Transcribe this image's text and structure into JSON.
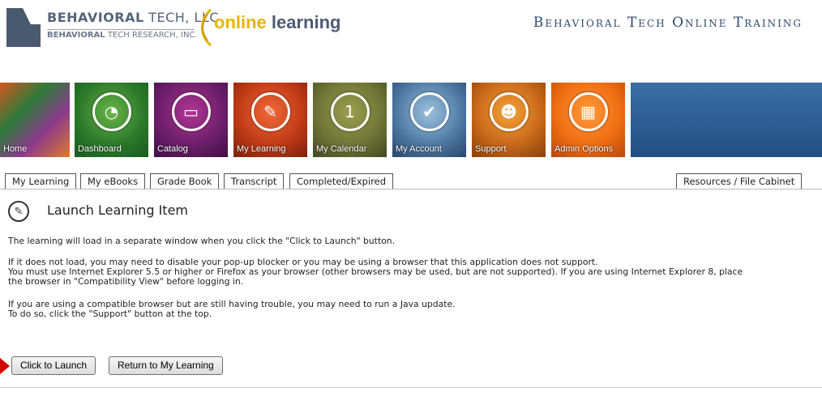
{
  "brand": {
    "company_line1_bold": "BEHAVIORAL",
    "company_line1_light": " TECH, LLC",
    "company_line2_bold": "BEHAVIORAL",
    "company_line2_light": " TECH RESEARCH, INC.",
    "online_learning_part1": "online",
    "online_learning_part2": " learning",
    "site_title": "Behavioral Tech Online Training"
  },
  "nav": {
    "items": [
      {
        "label": "Home",
        "icon": "home-icon"
      },
      {
        "label": "Dashboard",
        "icon": "gauge-icon",
        "glyph": "◔"
      },
      {
        "label": "Catalog",
        "icon": "folder-icon",
        "glyph": "▭"
      },
      {
        "label": "My Learning",
        "icon": "learning-icon",
        "glyph": "✎"
      },
      {
        "label": "My Calendar",
        "icon": "calendar-icon",
        "glyph": "1"
      },
      {
        "label": "My Account",
        "icon": "checkmark-icon",
        "glyph": "✔"
      },
      {
        "label": "Support",
        "icon": "people-icon",
        "glyph": "☻"
      },
      {
        "label": "Admin Options",
        "icon": "admin-blocks-icon",
        "glyph": "▦"
      }
    ]
  },
  "tabs": {
    "left": [
      "My Learning",
      "My eBooks",
      "Grade Book",
      "Transcript",
      "Completed/Expired"
    ],
    "right": "Resources / File Cabinet"
  },
  "main": {
    "title": "Launch Learning Item",
    "p1": "The learning will load in a separate window when you click the \"Click to Launch\" button.",
    "p2a": "If it does not load, you may need to disable your pop-up blocker or you may be using a browser that this application does not support.",
    "p2b": "You must use Internet Explorer 5.5 or higher or Firefox as your browser (other browsers may be used, but are not supported). If you are using Internet Explorer 8, place",
    "p2c": "the browser in \"Compatibility View\" before logging in.",
    "p3a": "If you are using a compatible browser but are still having trouble, you may need to run a Java update.",
    "p3b": "To do so, click the \"Support\" button at the top.",
    "launch_button": "Click to Launch",
    "return_button": "Return to My Learning"
  },
  "colors": {
    "marker": "#d40000",
    "title_blue": "#2f4a6a"
  }
}
